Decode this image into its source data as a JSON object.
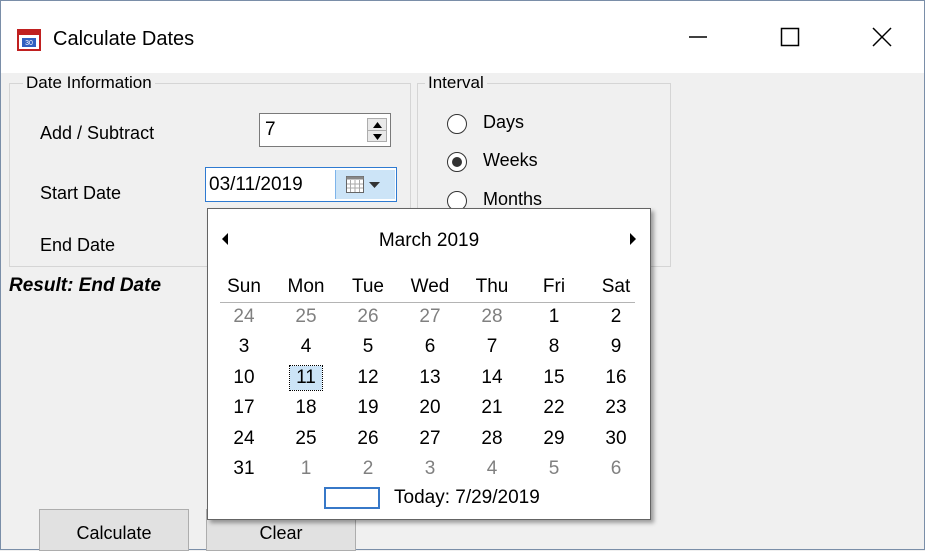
{
  "window": {
    "title": "Calculate Dates",
    "icon": "calendar-app-icon",
    "controls": [
      "minimize-icon",
      "maximize-icon",
      "close-icon"
    ]
  },
  "date_info": {
    "group_label": "Date Information",
    "add_subtract_label": "Add / Subtract",
    "add_subtract_value": "7",
    "start_date_label": "Start Date",
    "start_date_value": "03/11/2019",
    "end_date_label": "End Date"
  },
  "interval": {
    "group_label": "Interval",
    "options": [
      {
        "label": "Days",
        "checked": false
      },
      {
        "label": "Weeks",
        "checked": true
      },
      {
        "label": "Months",
        "checked": false
      }
    ]
  },
  "result_label": "Result: End Date",
  "buttons": {
    "calculate": "Calculate",
    "clear": "Clear"
  },
  "calendar": {
    "month": "March 2019",
    "weekdays": [
      "Sun",
      "Mon",
      "Tue",
      "Wed",
      "Thu",
      "Fri",
      "Sat"
    ],
    "weeks": [
      [
        "24",
        "25",
        "26",
        "27",
        "28",
        "1",
        "2"
      ],
      [
        "3",
        "4",
        "5",
        "6",
        "7",
        "8",
        "9"
      ],
      [
        "10",
        "11",
        "12",
        "13",
        "14",
        "15",
        "16"
      ],
      [
        "17",
        "18",
        "19",
        "20",
        "21",
        "22",
        "23"
      ],
      [
        "24",
        "25",
        "26",
        "27",
        "28",
        "29",
        "30"
      ],
      [
        "31",
        "1",
        "2",
        "3",
        "4",
        "5",
        "6"
      ]
    ],
    "selected_day": "11",
    "today_text": "Today: 7/29/2019",
    "colors": {
      "selected_bg": "#cce4f7",
      "today_border": "#3778c8",
      "trailing_text": "#808080"
    }
  }
}
